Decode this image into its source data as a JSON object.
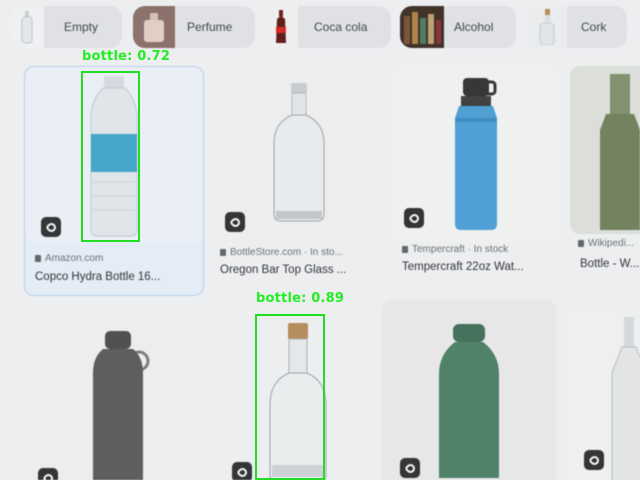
{
  "chips": [
    {
      "label": "Empty",
      "thumb_icon": "clear-bottle-icon"
    },
    {
      "label": "Perfume",
      "thumb_icon": "perfume-bottle-photo"
    },
    {
      "label": "Coca cola",
      "thumb_icon": "cola-bottle-icon"
    },
    {
      "label": "Alcohol",
      "thumb_icon": "liquor-shelf-photo"
    },
    {
      "label": "Cork",
      "thumb_icon": "corked-bottle-icon"
    }
  ],
  "results": [
    {
      "source": "Amazon.com",
      "title": "Copco Hydra Bottle 16..."
    },
    {
      "source": "BottleStore.com · In sto...",
      "title": "Oregon Bar Top Glass ..."
    },
    {
      "source": "Tempercraft · In stock",
      "title": "Tempercraft 22oz Wat..."
    },
    {
      "source": "Wikipedi...",
      "title": "Bottle - W..."
    }
  ],
  "detections": [
    {
      "label": "bottle: 0.72",
      "class": "bottle",
      "score": 0.72
    },
    {
      "label": "bottle: 0.89",
      "class": "bottle",
      "score": 0.89
    }
  ],
  "colors": {
    "box": "#22dd22",
    "selected_card": "#b9d2f2"
  }
}
